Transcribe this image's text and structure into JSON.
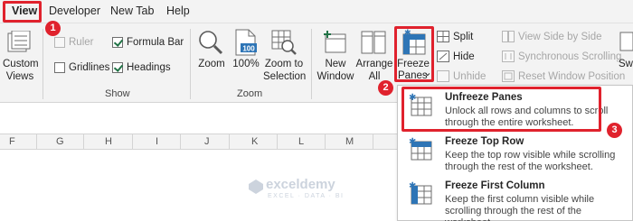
{
  "tabs": [
    {
      "label": "View",
      "active": true
    },
    {
      "label": "Developer"
    },
    {
      "label": "New Tab"
    },
    {
      "label": "Help"
    }
  ],
  "ribbon": {
    "custom_views": {
      "line1": "Custom",
      "line2": "Views"
    },
    "show": {
      "ruler": {
        "label": "Ruler",
        "checked": false,
        "disabled": true
      },
      "gridlines": {
        "label": "Gridlines",
        "checked": false
      },
      "formula_bar": {
        "label": "Formula Bar",
        "checked": true
      },
      "headings": {
        "label": "Headings",
        "checked": true
      },
      "group_label": "Show"
    },
    "zoom": {
      "zoom_label": "Zoom",
      "hundred_label": "100%",
      "hundred_icon_text": "100",
      "zoom_to_selection": {
        "line1": "Zoom to",
        "line2": "Selection"
      },
      "group_label": "Zoom"
    },
    "window": {
      "new_window": {
        "line1": "New",
        "line2": "Window"
      },
      "arrange_all": {
        "line1": "Arrange",
        "line2": "All"
      },
      "freeze_panes": {
        "line1": "Freeze",
        "line2": "Panes",
        "caret": "⌄"
      },
      "split": "Split",
      "hide": "Hide",
      "unhide": "Unhide",
      "view_side_by_side": "View Side by Side",
      "synchronous_scrolling": "Synchronous Scrolling",
      "reset_window_position": "Reset Window Position",
      "swi": "Swi"
    }
  },
  "markers": [
    "1",
    "2",
    "3"
  ],
  "columns": [
    "F",
    "G",
    "H",
    "I",
    "J",
    "K",
    "L",
    "M"
  ],
  "freeze_menu": [
    {
      "title": "Unfreeze Panes",
      "accel": "n",
      "description": "Unlock all rows and columns to scroll through the entire worksheet."
    },
    {
      "title": "Freeze Top Row",
      "accel": "R",
      "description": "Keep the top row visible while scrolling through the rest of the worksheet."
    },
    {
      "title": "Freeze First Column",
      "accel": "C",
      "description": "Keep the first column visible while scrolling through the rest of the worksheet."
    }
  ],
  "watermark": {
    "name": "exceldemy",
    "tagline": "EXCEL · DATA · BI"
  },
  "colors": {
    "excel_green": "#217346",
    "marker_red": "#e0222d",
    "freeze_blue": "#2e75b6"
  }
}
